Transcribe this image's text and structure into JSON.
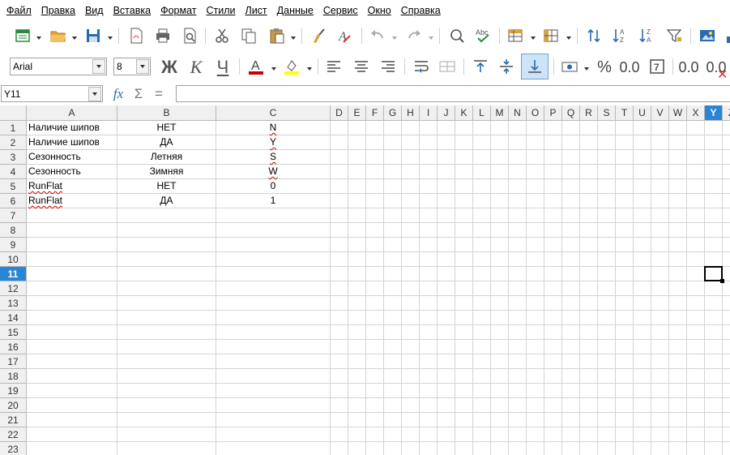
{
  "menubar": {
    "items": [
      {
        "label": "Файл",
        "name": "menu-file"
      },
      {
        "label": "Правка",
        "name": "menu-edit"
      },
      {
        "label": "Вид",
        "name": "menu-view"
      },
      {
        "label": "Вставка",
        "name": "menu-insert"
      },
      {
        "label": "Формат",
        "name": "menu-format"
      },
      {
        "label": "Стили",
        "name": "menu-styles"
      },
      {
        "label": "Лист",
        "name": "menu-sheet"
      },
      {
        "label": "Данные",
        "name": "menu-data"
      },
      {
        "label": "Сервис",
        "name": "menu-tools"
      },
      {
        "label": "Окно",
        "name": "menu-window"
      },
      {
        "label": "Справка",
        "name": "menu-help"
      }
    ]
  },
  "formatting": {
    "font_name": "Arial",
    "font_size": "8",
    "bold_glyph": "Ж",
    "italic_glyph": "К",
    "underline_glyph": "Ч",
    "font_color_glyph": "A",
    "font_color": "#cc0000",
    "highlight_color": "#ffff00",
    "percent_glyph": "%",
    "number_glyph": "0.0",
    "add_decimal_glyph": "0.0",
    "del_decimal_glyph": "0.0"
  },
  "formula_bar": {
    "name_box": "Y11",
    "fx_glyph": "fx",
    "sum_glyph": "Σ",
    "equals_glyph": "=",
    "content": ""
  },
  "sheet": {
    "columns": [
      "A",
      "B",
      "C",
      "D",
      "E",
      "F",
      "G",
      "H",
      "I",
      "J",
      "K",
      "L",
      "M",
      "N",
      "O",
      "P",
      "Q",
      "R",
      "S",
      "T",
      "U",
      "V",
      "W",
      "X",
      "Y",
      "Z"
    ],
    "selected_column": "Y",
    "selected_row": "11",
    "rows": [
      "1",
      "2",
      "3",
      "4",
      "5",
      "6",
      "7",
      "8",
      "9",
      "10",
      "11",
      "12",
      "13",
      "14",
      "15",
      "16",
      "17",
      "18",
      "19",
      "20",
      "21",
      "22",
      "23"
    ],
    "data": [
      [
        "Наличие шипов",
        "НЕТ",
        "N"
      ],
      [
        "Наличие шипов",
        "ДА",
        "Y"
      ],
      [
        "Сезонность",
        "Летняя",
        "S"
      ],
      [
        "Сезонность",
        "Зимняя",
        "W"
      ],
      [
        "RunFlat",
        "НЕТ",
        "0"
      ],
      [
        "RunFlat",
        "ДА",
        "1"
      ]
    ]
  },
  "colors": {
    "header_bg": "#f0f0f0",
    "selection": "#2a85d6",
    "grid_line": "#d4d4d4"
  }
}
